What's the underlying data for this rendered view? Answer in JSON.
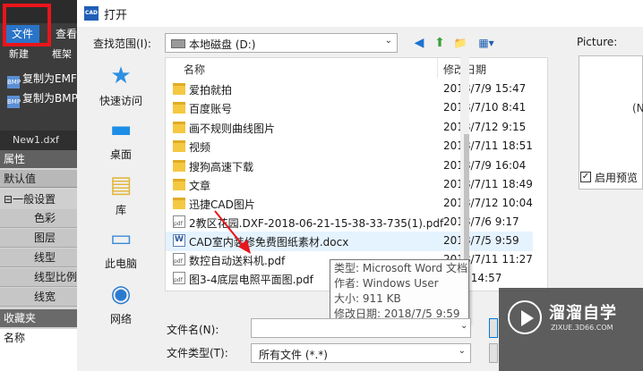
{
  "cad_app": {
    "menu_file": "文件",
    "menu_view": "查看",
    "ribbon_sub_items": [
      "新建",
      "框架"
    ],
    "buttons": [
      {
        "icon": "bmp-icon",
        "label": "复制为EMF"
      },
      {
        "icon": "bmp-icon",
        "label": "复制为BMP"
      }
    ],
    "bmp_badge": "BMP",
    "doc_tab": "New1.dxf",
    "properties_header": "属性",
    "default_value": "默认值",
    "general_section": "一般设置",
    "general_toggle": "⊟",
    "properties": [
      "色彩",
      "图层",
      "线型",
      "线型比例",
      "线宽"
    ],
    "favorites_header": "收藏夹",
    "favorites_name_col": "名称"
  },
  "dialog": {
    "title": "打开",
    "app_icon_text": "CAD",
    "look_in_label": "查找范围(I):",
    "look_in_value": "本地磁盘 (D:)",
    "toolbar": {
      "back_icon": "◀",
      "up_icon": "⬆",
      "new_folder_icon": "📁",
      "view_menu_icon": "▦▾"
    },
    "places": [
      {
        "icon": "★",
        "label": "快速访问"
      },
      {
        "icon": "▬",
        "label": "桌面"
      },
      {
        "icon": "▤",
        "label": "库"
      },
      {
        "icon": "▭",
        "label": "此电脑"
      },
      {
        "icon": "◉",
        "label": "网络"
      }
    ],
    "columns": {
      "name": "名称",
      "date": "修改日期"
    },
    "files": [
      {
        "type": "folder",
        "name": "爱拍就拍",
        "date": "2018/7/9 15:47"
      },
      {
        "type": "folder",
        "name": "百度账号",
        "date": "2018/7/10 8:41"
      },
      {
        "type": "folder",
        "name": "画不规则曲线图片",
        "date": "2018/7/12 9:15"
      },
      {
        "type": "folder",
        "name": "视频",
        "date": "2018/7/11 18:51"
      },
      {
        "type": "folder",
        "name": "搜狗高速下载",
        "date": "2018/7/9 16:04"
      },
      {
        "type": "folder",
        "name": "文章",
        "date": "2018/7/11 18:49"
      },
      {
        "type": "folder",
        "name": "迅捷CAD图片",
        "date": "2018/7/12 10:04"
      },
      {
        "type": "pdf",
        "name": "2教区花园.DXF-2018-06-21-15-38-33-735(1).pdf",
        "date": "2018/7/6 9:17"
      },
      {
        "type": "doc",
        "name": "CAD室内装修免费图纸素材.docx",
        "date": "2018/7/5 9:59"
      },
      {
        "type": "pdf",
        "name": "数控自动送料机.pdf",
        "date": "2018/7/11 11:27"
      },
      {
        "type": "pdf",
        "name": "图3-4底层电照平面图.pdf",
        "date": "5/21 14:57"
      }
    ],
    "tooltip": {
      "type": "类型: Microsoft Word 文档",
      "author": "作者: Windows User",
      "size": "大小: 911 KB",
      "modified": "修改日期: 2018/7/5 9:59"
    },
    "file_name_label": "文件名(N):",
    "file_name_value": "",
    "file_type_label": "文件类型(T):",
    "file_type_value": "所有文件 (*.*)",
    "preview_label": "Picture:",
    "preview_cut_text": "(N",
    "preview_check_label": "启用预览",
    "preview_checked": "✓"
  },
  "watermark": {
    "text": "溜溜自学",
    "url": "ZIXUE.3D66.COM"
  },
  "colors": {
    "highlight_red": "#e8151b",
    "menu_blue": "#2a74c8",
    "selection": "#e5f3ff"
  }
}
